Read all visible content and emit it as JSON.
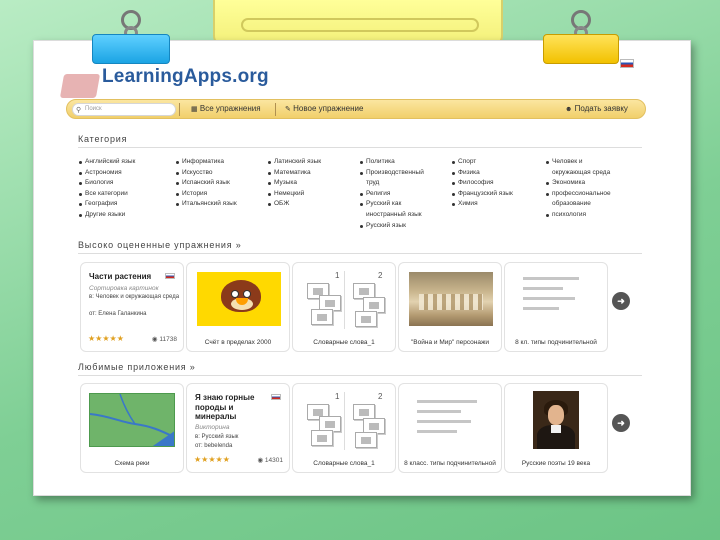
{
  "site": {
    "logo": "LearningApps.org"
  },
  "navbar": {
    "search_placeholder": "Поиск",
    "all_exercises": "Все упражнения",
    "new_exercise": "Новое упражнение",
    "submit_request": "Подать заявку"
  },
  "categories": {
    "title": "Категория",
    "columns": [
      [
        "Английский язык",
        "Астрономия",
        "Биология",
        "Все категории",
        "География",
        "Другие языки"
      ],
      [
        "Информатика",
        "Искусство",
        "Испанский язык",
        "История",
        "Итальянский язык"
      ],
      [
        "Латинский язык",
        "Математика",
        "Музыка",
        "Немецкий",
        "ОБЖ"
      ],
      [
        "Политика",
        "Производственный труд",
        "Религия",
        "Русский как иностранный язык",
        "Русский язык"
      ],
      [
        "Спорт",
        "Физика",
        "Философия",
        "Французский язык",
        "Химия"
      ],
      [
        "Человек и окружающая среда",
        "Экономика",
        "профессиональное образование",
        "психология"
      ]
    ]
  },
  "top_rated": {
    "title": "Высоко оцененные упражнения »",
    "cards": [
      {
        "title": "Части растения",
        "type": "Сортировка картинок",
        "category": "в: Человек и окружающая среда",
        "author": "от: Елена Галанкина",
        "stars": "★★★★★",
        "views": "11738"
      },
      {
        "caption": "Счёт в пределах 2000"
      },
      {
        "caption": "Словарные слова_1",
        "num1": "1",
        "num2": "2"
      },
      {
        "caption": "\"Война и Мир\" персонажи"
      },
      {
        "caption": "8 кл. типы подчинительной"
      }
    ]
  },
  "favorites": {
    "title": "Любимые приложения »",
    "cards": [
      {
        "caption": "Схема реки"
      },
      {
        "title": "Я знаю горные породы и минералы",
        "type": "Викторина",
        "category": "в: Русский язык",
        "author": "от: bebelenda",
        "stars": "★★★★★",
        "views": "14301"
      },
      {
        "caption": "Словарные слова_1",
        "num1": "1",
        "num2": "2"
      },
      {
        "caption": "8 класс. типы подчинительной"
      },
      {
        "caption": "Русские поэты 19 века"
      }
    ]
  },
  "icons": {
    "next": "arrow-right-icon",
    "search": "search-icon",
    "eye": "eye-icon",
    "user": "user-icon"
  }
}
